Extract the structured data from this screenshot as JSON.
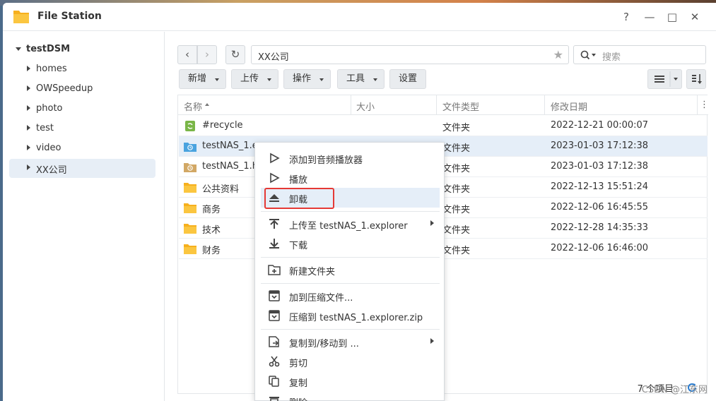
{
  "window": {
    "title": "File Station",
    "help": "?",
    "minimize": "—",
    "maximize": "□",
    "close": "✕"
  },
  "sidebar": {
    "root": "testDSM",
    "items": [
      {
        "label": "homes"
      },
      {
        "label": "OWSpeedup"
      },
      {
        "label": "photo"
      },
      {
        "label": "test"
      },
      {
        "label": "video"
      },
      {
        "label": "XX公司"
      }
    ]
  },
  "navigation": {
    "back": "‹",
    "forward": "›",
    "refresh": "↻",
    "path": "XX公司",
    "favorite": "★",
    "search_placeholder": "搜索"
  },
  "toolbar": {
    "new": "新增",
    "upload": "上传",
    "action": "操作",
    "tools": "工具",
    "settings": "设置"
  },
  "columns": {
    "name": "名称",
    "size": "大小",
    "type": "文件类型",
    "modified": "修改日期"
  },
  "files": [
    {
      "name": "#recycle",
      "type": "文件夹",
      "date": "2022-12-21 00:00:07",
      "icon": "recycle-icon"
    },
    {
      "name": "testNAS_1.e",
      "type": "文件夹",
      "date": "2023-01-03 17:12:38",
      "icon": "explorer-folder-icon"
    },
    {
      "name": "testNAS_1.h",
      "type": "文件夹",
      "date": "2023-01-03 17:12:38",
      "icon": "timer-folder-icon"
    },
    {
      "name": "公共资料",
      "type": "文件夹",
      "date": "2022-12-13 15:51:24",
      "icon": "folder-icon"
    },
    {
      "name": "商务",
      "type": "文件夹",
      "date": "2022-12-06 16:45:55",
      "icon": "folder-icon"
    },
    {
      "name": "技术",
      "type": "文件夹",
      "date": "2022-12-28 14:35:33",
      "icon": "folder-icon"
    },
    {
      "name": "财务",
      "type": "文件夹",
      "date": "2022-12-06 16:46:00",
      "icon": "folder-icon"
    }
  ],
  "status": {
    "count": "7 个项目"
  },
  "watermark": "CSDN @江东网",
  "context_menu": {
    "add_to_player": "添加到音频播放器",
    "play": "播放",
    "unmount": "卸载",
    "upload_to": "上传至 testNAS_1.explorer",
    "download": "下载",
    "new_folder": "新建文件夹",
    "add_to_archive": "加到压缩文件...",
    "compress_to": "压缩到 testNAS_1.explorer.zip",
    "copy_move_to": "复制到/移动到 ...",
    "cut": "剪切",
    "copy": "复制",
    "delete": "删除"
  },
  "colors": {
    "folder": "#f6b01e",
    "highlight": "#e5eef8",
    "annotation": "#e53935",
    "recycle": "#7ab648",
    "accent": "#2a7ccf"
  }
}
